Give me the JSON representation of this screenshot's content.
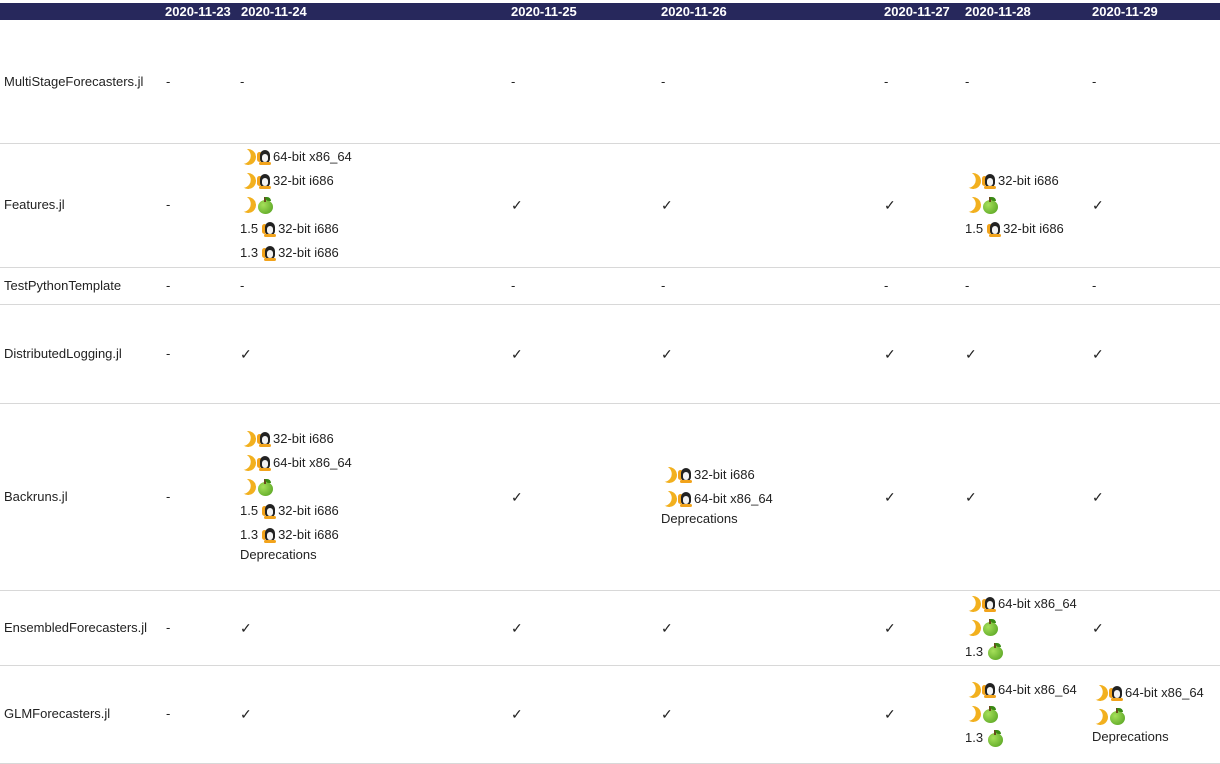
{
  "header": {
    "dates": [
      "2020-11-23",
      "2020-11-24",
      "2020-11-25",
      "2020-11-26",
      "2020-11-27",
      "2020-11-28",
      "2020-11-29"
    ]
  },
  "icons": {
    "moon": "crescent-moon-icon",
    "linux": "linux-penguin-icon",
    "mac": "green-apple-icon"
  },
  "rows": [
    {
      "name": "MultiStageForecasters.jl",
      "cells": [
        [
          {
            "t": "text",
            "v": "-"
          }
        ],
        [
          {
            "t": "text",
            "v": "-"
          }
        ],
        [
          {
            "t": "text",
            "v": "-"
          }
        ],
        [
          {
            "t": "text",
            "v": "-"
          }
        ],
        [
          {
            "t": "text",
            "v": "-"
          }
        ],
        [
          {
            "t": "text",
            "v": "-"
          }
        ],
        [
          {
            "t": "text",
            "v": "-"
          }
        ]
      ]
    },
    {
      "name": "Features.jl",
      "cells": [
        [
          {
            "t": "text",
            "v": "-"
          }
        ],
        [
          {
            "t": "fail",
            "moon": true,
            "os": "linux",
            "label": "64-bit x86_64"
          },
          {
            "t": "fail",
            "moon": true,
            "os": "linux",
            "label": "32-bit i686"
          },
          {
            "t": "fail",
            "moon": true,
            "os": "mac",
            "label": ""
          },
          {
            "t": "fail",
            "ver": "1.5",
            "os": "linux",
            "label": "32-bit i686"
          },
          {
            "t": "fail",
            "ver": "1.3",
            "os": "linux",
            "label": "32-bit i686"
          }
        ],
        [
          {
            "t": "check",
            "v": "✓"
          }
        ],
        [
          {
            "t": "check",
            "v": "✓"
          }
        ],
        [
          {
            "t": "check",
            "v": "✓"
          }
        ],
        [
          {
            "t": "fail",
            "moon": true,
            "os": "linux",
            "label": "32-bit i686"
          },
          {
            "t": "fail",
            "moon": true,
            "os": "mac",
            "label": ""
          },
          {
            "t": "fail",
            "ver": "1.5",
            "os": "linux",
            "label": "32-bit i686"
          }
        ],
        [
          {
            "t": "check",
            "v": "✓"
          }
        ]
      ]
    },
    {
      "name": "TestPythonTemplate",
      "cells": [
        [
          {
            "t": "text",
            "v": "-"
          }
        ],
        [
          {
            "t": "text",
            "v": "-"
          }
        ],
        [
          {
            "t": "text",
            "v": "-"
          }
        ],
        [
          {
            "t": "text",
            "v": "-"
          }
        ],
        [
          {
            "t": "text",
            "v": "-"
          }
        ],
        [
          {
            "t": "text",
            "v": "-"
          }
        ],
        [
          {
            "t": "text",
            "v": "-"
          }
        ]
      ]
    },
    {
      "name": "DistributedLogging.jl",
      "cells": [
        [
          {
            "t": "text",
            "v": "-"
          }
        ],
        [
          {
            "t": "check",
            "v": "✓"
          }
        ],
        [
          {
            "t": "check",
            "v": "✓"
          }
        ],
        [
          {
            "t": "check",
            "v": "✓"
          }
        ],
        [
          {
            "t": "check",
            "v": "✓"
          }
        ],
        [
          {
            "t": "check",
            "v": "✓"
          }
        ],
        [
          {
            "t": "check",
            "v": "✓"
          }
        ]
      ]
    },
    {
      "name": "Backruns.jl",
      "cells": [
        [
          {
            "t": "text",
            "v": "-"
          }
        ],
        [
          {
            "t": "fail",
            "moon": true,
            "os": "linux",
            "label": "32-bit i686"
          },
          {
            "t": "fail",
            "moon": true,
            "os": "linux",
            "label": "64-bit x86_64"
          },
          {
            "t": "fail",
            "moon": true,
            "os": "mac",
            "label": ""
          },
          {
            "t": "fail",
            "ver": "1.5",
            "os": "linux",
            "label": "32-bit i686"
          },
          {
            "t": "fail",
            "ver": "1.3",
            "os": "linux",
            "label": "32-bit i686"
          },
          {
            "t": "note",
            "v": "Deprecations"
          }
        ],
        [
          {
            "t": "check",
            "v": "✓"
          }
        ],
        [
          {
            "t": "fail",
            "moon": true,
            "os": "linux",
            "label": "32-bit i686"
          },
          {
            "t": "fail",
            "moon": true,
            "os": "linux",
            "label": "64-bit x86_64"
          },
          {
            "t": "note",
            "v": "Deprecations"
          }
        ],
        [
          {
            "t": "check",
            "v": "✓"
          }
        ],
        [
          {
            "t": "check",
            "v": "✓"
          }
        ],
        [
          {
            "t": "check",
            "v": "✓"
          }
        ]
      ]
    },
    {
      "name": "EnsembledForecasters.jl",
      "cells": [
        [
          {
            "t": "text",
            "v": "-"
          }
        ],
        [
          {
            "t": "check",
            "v": "✓"
          }
        ],
        [
          {
            "t": "check",
            "v": "✓"
          }
        ],
        [
          {
            "t": "check",
            "v": "✓"
          }
        ],
        [
          {
            "t": "check",
            "v": "✓"
          }
        ],
        [
          {
            "t": "fail",
            "moon": true,
            "os": "linux",
            "label": "64-bit x86_64"
          },
          {
            "t": "fail",
            "moon": true,
            "os": "mac",
            "label": ""
          },
          {
            "t": "fail",
            "ver": "1.3",
            "os": "mac",
            "label": ""
          }
        ],
        [
          {
            "t": "check",
            "v": "✓"
          }
        ]
      ]
    },
    {
      "name": "GLMForecasters.jl",
      "cells": [
        [
          {
            "t": "text",
            "v": "-"
          }
        ],
        [
          {
            "t": "check",
            "v": "✓"
          }
        ],
        [
          {
            "t": "check",
            "v": "✓"
          }
        ],
        [
          {
            "t": "check",
            "v": "✓"
          }
        ],
        [
          {
            "t": "check",
            "v": "✓"
          }
        ],
        [
          {
            "t": "fail",
            "moon": true,
            "os": "linux",
            "label": "64-bit x86_64"
          },
          {
            "t": "fail",
            "moon": true,
            "os": "mac",
            "label": ""
          },
          {
            "t": "fail",
            "ver": "1.3",
            "os": "mac",
            "label": ""
          }
        ],
        [
          {
            "t": "fail",
            "moon": true,
            "os": "linux",
            "label": "64-bit x86_64"
          },
          {
            "t": "fail",
            "moon": true,
            "os": "mac",
            "label": ""
          },
          {
            "t": "note",
            "v": "Deprecations"
          }
        ]
      ]
    }
  ]
}
